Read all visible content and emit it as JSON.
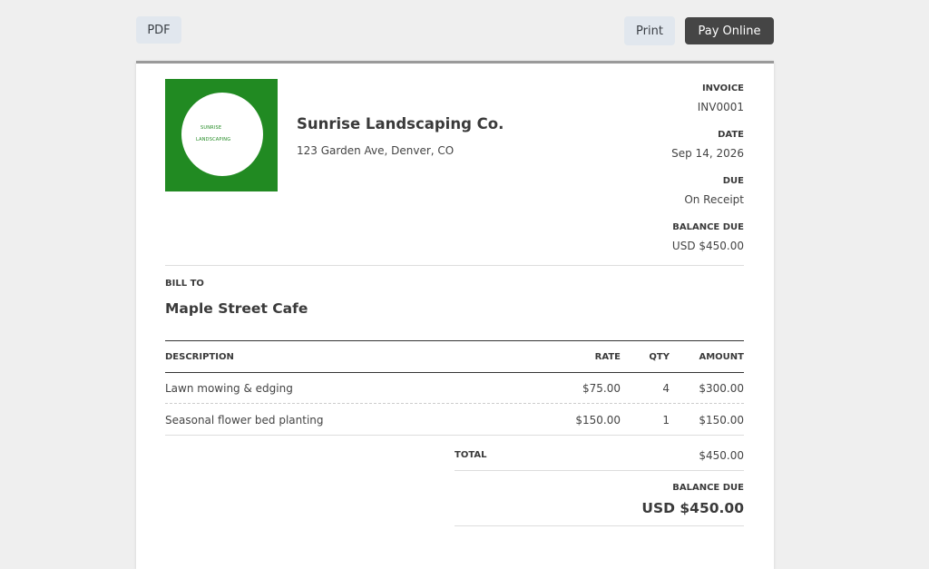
{
  "toolbar": {
    "pdf_label": "PDF",
    "print_label": "Print",
    "pay_label": "Pay Online"
  },
  "logo": {
    "line1": "SUNRISE",
    "line2": "LANDSCAPING"
  },
  "company": {
    "name": "Sunrise Landscaping Co.",
    "address": "123 Garden Ave, Denver, CO"
  },
  "meta": {
    "invoice_label": "INVOICE",
    "invoice_number": "INV0001",
    "date_label": "DATE",
    "date_value": "Sep 14, 2026",
    "due_label": "DUE",
    "due_value": "On Receipt",
    "balance_label": "BALANCE DUE",
    "balance_value": "USD $450.00"
  },
  "bill_to": {
    "label": "BILL TO",
    "name": "Maple Street Cafe"
  },
  "table": {
    "headers": {
      "description": "DESCRIPTION",
      "rate": "RATE",
      "qty": "QTY",
      "amount": "AMOUNT"
    },
    "rows": [
      {
        "description": "Lawn mowing & edging",
        "rate": "$75.00",
        "qty": "4",
        "amount": "$300.00"
      },
      {
        "description": "Seasonal flower bed planting",
        "rate": "$150.00",
        "qty": "1",
        "amount": "$150.00"
      }
    ]
  },
  "totals": {
    "total_label": "TOTAL",
    "total_value": "$450.00",
    "balance_label": "BALANCE DUE",
    "balance_value": "USD $450.00"
  },
  "colors": {
    "logo_green": "#218a22",
    "pay_button": "#454545",
    "light_button": "#e1e7ee"
  }
}
